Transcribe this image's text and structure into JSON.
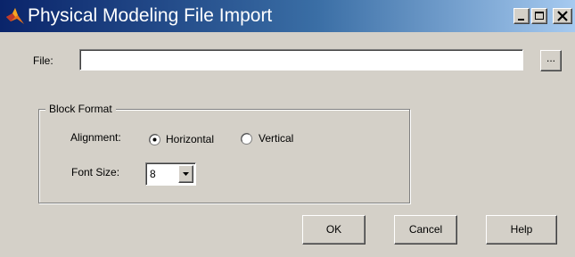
{
  "window": {
    "title": "Physical Modeling File Import",
    "icon": "matlab-icon",
    "controls": [
      "minimize-icon",
      "maximize-icon",
      "close-icon"
    ]
  },
  "file": {
    "label": "File:",
    "value": "",
    "browse_label": "..."
  },
  "block_format": {
    "legend": "Block Format",
    "alignment": {
      "label": "Alignment:",
      "options": [
        {
          "label": "Horizontal",
          "selected": true
        },
        {
          "label": "Vertical",
          "selected": false
        }
      ]
    },
    "font_size": {
      "label": "Font Size:",
      "value": "8"
    }
  },
  "buttons": {
    "ok": "OK",
    "cancel": "Cancel",
    "help": "Help"
  },
  "colors": {
    "dialog_bg": "#d4d0c8",
    "titlebar_start": "#0a246a",
    "titlebar_end": "#a6caf0"
  }
}
